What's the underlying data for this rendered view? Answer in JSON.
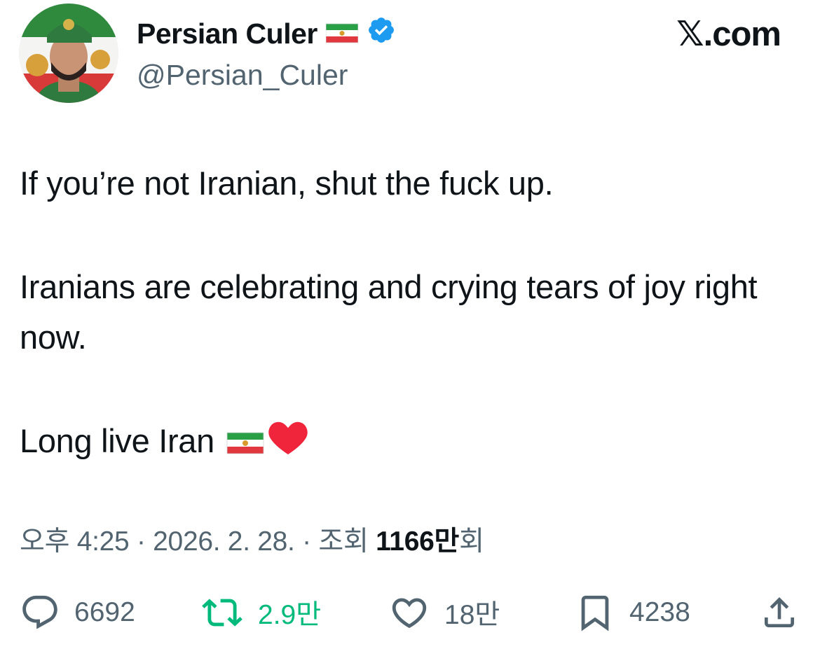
{
  "author": {
    "display_name": "Persian Culer",
    "name_flag": "🇮🇷",
    "verified": true,
    "handle": "@Persian_Culer",
    "avatar": "profile-photo"
  },
  "brand": "𝕏.com",
  "tweet": {
    "line1": "If you’re not Iranian, shut the fuck up.",
    "line2": "Iranians are celebrating and crying tears of joy right now.",
    "line3": "Long live Iran",
    "line3_emoji": "heart-emoji",
    "line3_flag": "lion-and-sun-flag-emoji"
  },
  "meta": {
    "time": "오후 4:25",
    "sep1": " · ",
    "date": "2026. 2. 28.",
    "sep2": " · ",
    "views_label": "조회 ",
    "views_count": "1166만",
    "views_suffix": "회"
  },
  "actions": {
    "replies": "6692",
    "retweets": "2.9만",
    "likes": "18만",
    "bookmarks": "4238"
  },
  "colors": {
    "text": "#0f1419",
    "muted": "#536471",
    "retweet": "#00ba7c",
    "verified": "#1d9bf0",
    "heart": "#f0243a"
  },
  "icons": [
    "reply-icon",
    "retweet-icon",
    "like-icon",
    "bookmark-icon",
    "share-icon",
    "verified-badge-icon"
  ]
}
